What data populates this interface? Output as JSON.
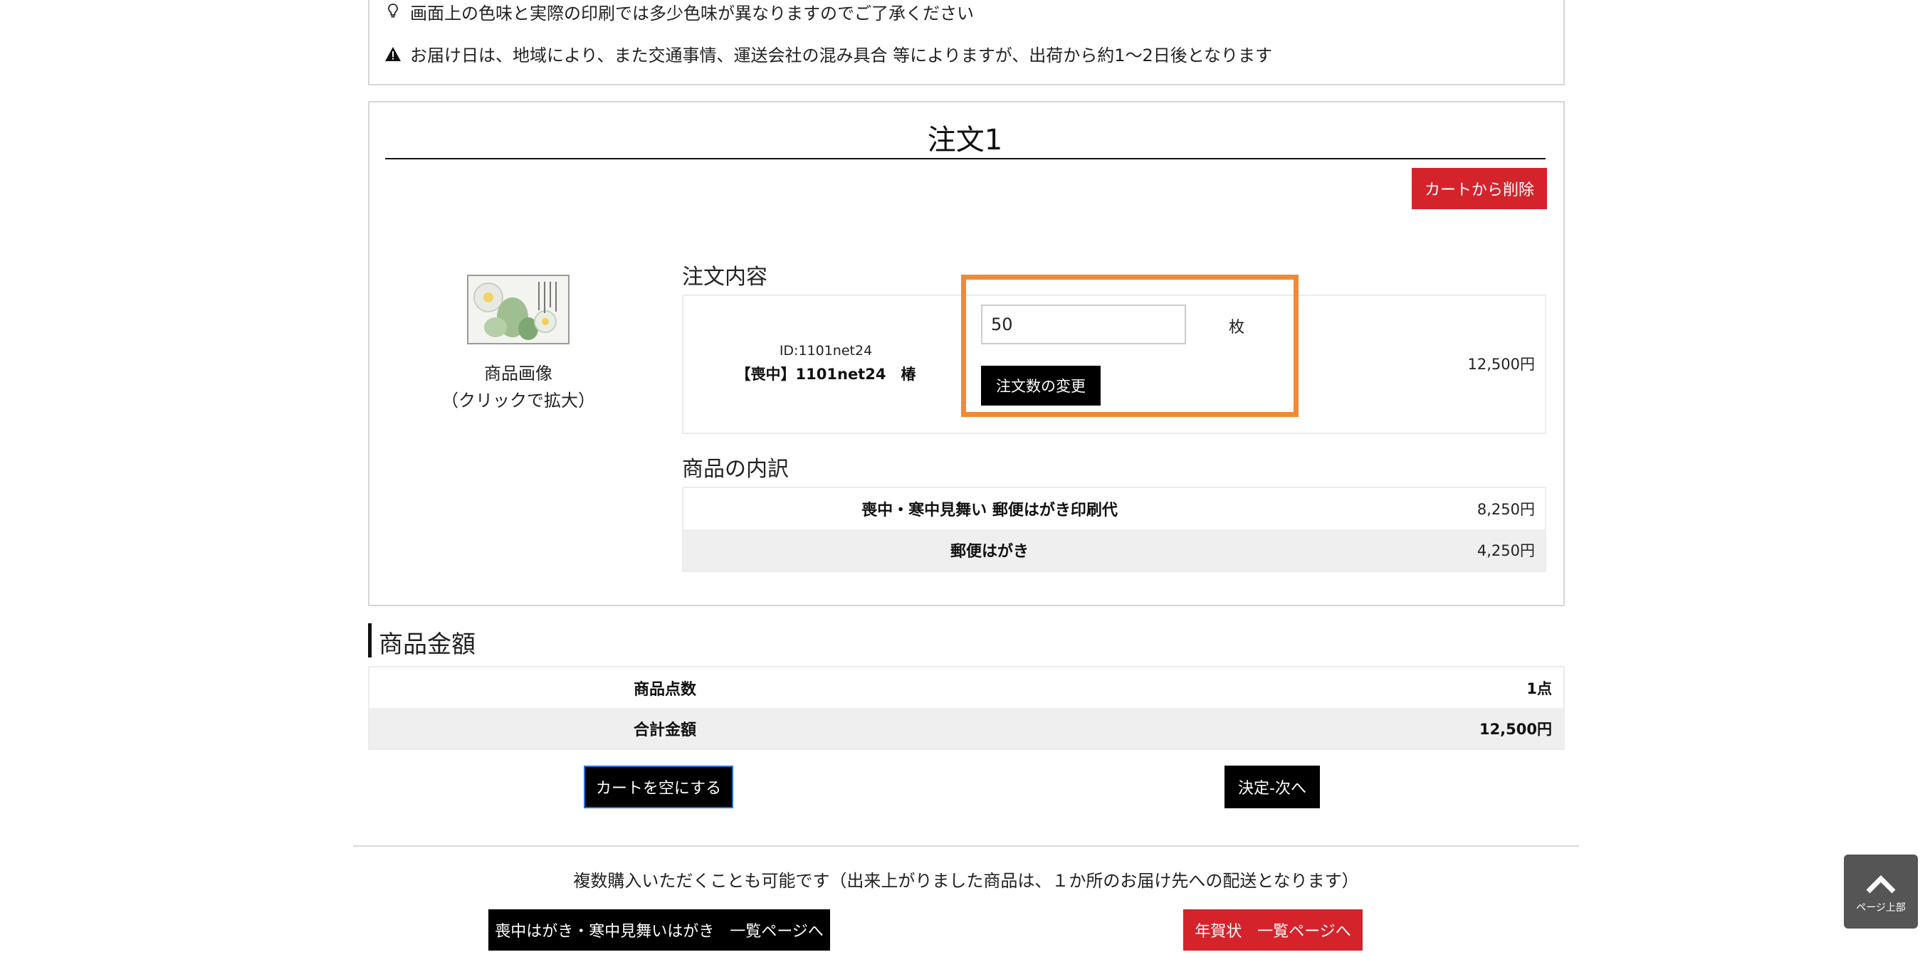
{
  "notices": {
    "color_note": "画面上の色味と実際の印刷では多少色味が異なりますのでご了承ください",
    "delivery_note": "お届け日は、地域により、また交通事情、運送会社の混み具合 等によりますが、出荷から約1～2日後となります"
  },
  "order": {
    "title": "注文1",
    "remove_button": "カートから削除",
    "product_image_label_line1": "商品画像",
    "product_image_label_line2": "（クリックで拡大）",
    "contents_heading": "注文内容",
    "product_id": "ID:1101net24",
    "product_name": "【喪中】1101net24　椿",
    "quantity_value": "50",
    "quantity_unit": "枚",
    "change_qty_button": "注文数の変更",
    "line_price": "12,500円",
    "breakdown_heading": "商品の内訳",
    "breakdown": [
      {
        "name": "喪中・寒中見舞い 郵便はがき印刷代",
        "price": "8,250円"
      },
      {
        "name": "郵便はがき",
        "price": "4,250円"
      }
    ]
  },
  "summary": {
    "heading": "商品金額",
    "rows": [
      {
        "label": "商品点数",
        "value": "1点"
      },
      {
        "label": "合計金額",
        "value": "12,500円"
      }
    ]
  },
  "actions": {
    "empty_cart": "カートを空にする",
    "proceed": "決定-次へ"
  },
  "footer": {
    "note": "複数購入いただくことも可能です（出来上がりました商品は、１か所のお届け先への配送となります）",
    "mourning_list_button": "喪中はがき・寒中見舞いはがき　一覧ページへ",
    "newyear_list_button": "年賀状　一覧ページへ",
    "page_top_label": "ページ上部"
  },
  "colors": {
    "accent_red": "#d4232b",
    "highlight_orange": "#f08a36",
    "row_gray": "#efefef"
  }
}
